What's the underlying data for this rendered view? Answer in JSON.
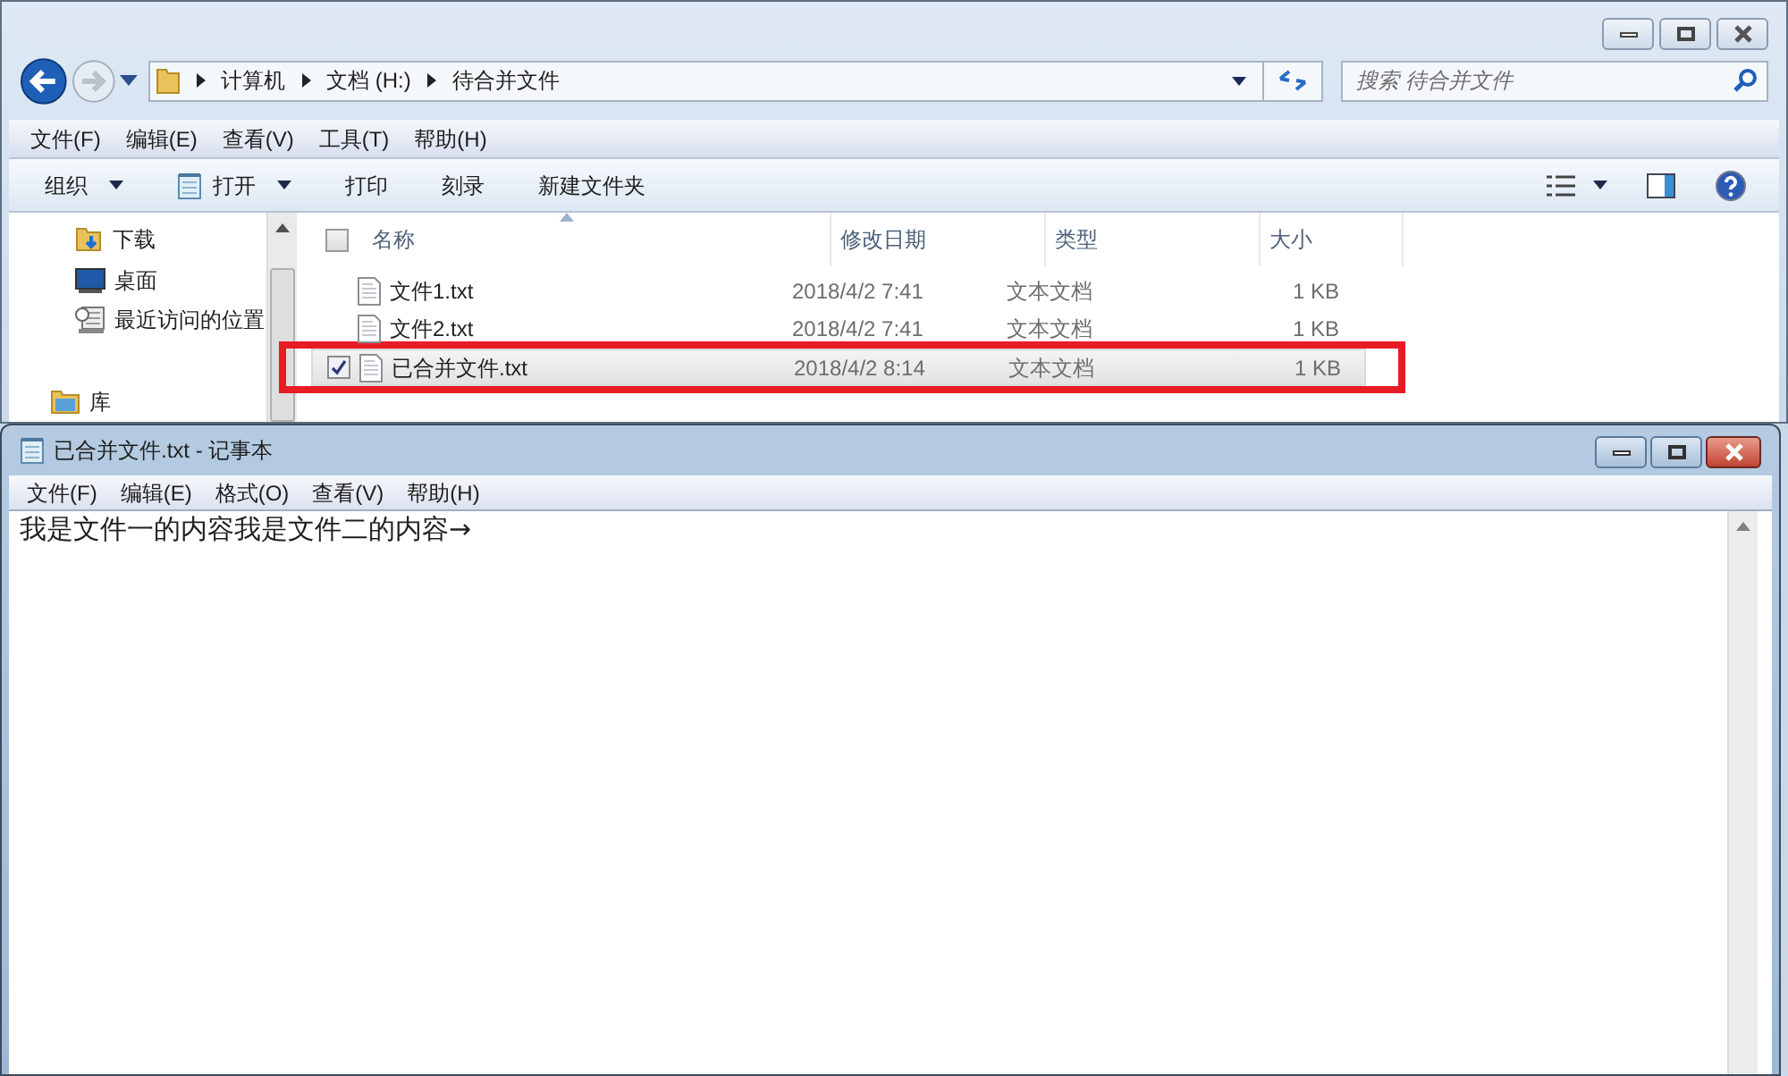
{
  "explorer": {
    "address_path": [
      "计算机",
      "文档 (H:)",
      "待合并文件"
    ],
    "search": {
      "placeholder": "搜索 待合并文件"
    },
    "menu": [
      "文件(F)",
      "编辑(E)",
      "查看(V)",
      "工具(T)",
      "帮助(H)"
    ],
    "toolbar": [
      {
        "label": "组织",
        "kind": "dropdown"
      },
      {
        "label": "打开",
        "kind": "app_dropdown"
      },
      {
        "label": "打印",
        "kind": "plain"
      },
      {
        "label": "刻录",
        "kind": "plain"
      },
      {
        "label": "新建文件夹",
        "kind": "plain"
      }
    ],
    "nav_items": [
      {
        "label": "下载",
        "kind": "downloads"
      },
      {
        "label": "桌面",
        "kind": "desktop"
      },
      {
        "label": "最近访问的位置",
        "kind": "recent"
      },
      {
        "label": "库",
        "kind": "library"
      }
    ],
    "select_all": {
      "checked": false
    },
    "columns": [
      {
        "label": "名称",
        "sorted": true
      },
      {
        "label": "修改日期",
        "sorted": false
      },
      {
        "label": "类型",
        "sorted": false
      },
      {
        "label": "大小",
        "sorted": false
      }
    ],
    "files": [
      {
        "name": "文件1.txt",
        "modified": "2018/4/2 7:41",
        "type": "文本文档",
        "size": "1 KB",
        "selected": false,
        "checked": false,
        "highlighted": false
      },
      {
        "name": "文件2.txt",
        "modified": "2018/4/2 7:41",
        "type": "文本文档",
        "size": "1 KB",
        "selected": false,
        "checked": false,
        "highlighted": false
      },
      {
        "name": "已合并文件.txt",
        "modified": "2018/4/2 8:14",
        "type": "文本文档",
        "size": "1 KB",
        "selected": true,
        "checked": true,
        "highlighted": true
      }
    ]
  },
  "notepad": {
    "title": "已合并文件.txt - 记事本",
    "menu": [
      "文件(F)",
      "编辑(E)",
      "格式(O)",
      "查看(V)",
      "帮助(H)"
    ],
    "content": "我是文件一的内容我是文件二的内容→"
  }
}
